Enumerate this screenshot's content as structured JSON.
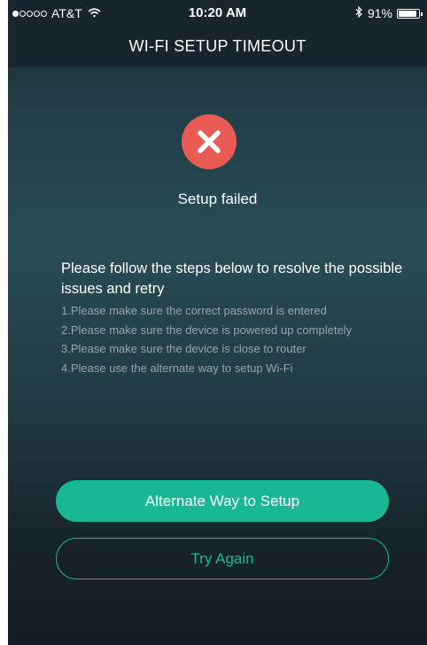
{
  "status_bar": {
    "carrier": "AT&T",
    "time": "10:20 AM",
    "battery_percent": "91%",
    "battery_level": 0.91,
    "signal_bars_filled": 1,
    "signal_bars_total": 5,
    "icons": [
      "wifi-icon",
      "bluetooth-icon",
      "battery-icon"
    ]
  },
  "header": {
    "title": "WI-FI SETUP TIMEOUT"
  },
  "result": {
    "icon": "error-x-icon",
    "icon_color": "#ea5b55",
    "title": "Setup failed"
  },
  "instructions": {
    "heading": "Please follow the steps below to resolve the possible issues and retry",
    "steps": [
      "1.Please make sure the correct password is entered",
      "2.Please make sure the device is powered up completely",
      "3.Please make sure the device is close to router",
      "4.Please use the alternate way to setup Wi-Fi"
    ]
  },
  "buttons": {
    "alternate_label": "Alternate Way to Setup",
    "try_again_label": "Try Again"
  },
  "colors": {
    "accent": "#18b894",
    "error": "#ea5b55",
    "header_bg": "#19252c"
  }
}
